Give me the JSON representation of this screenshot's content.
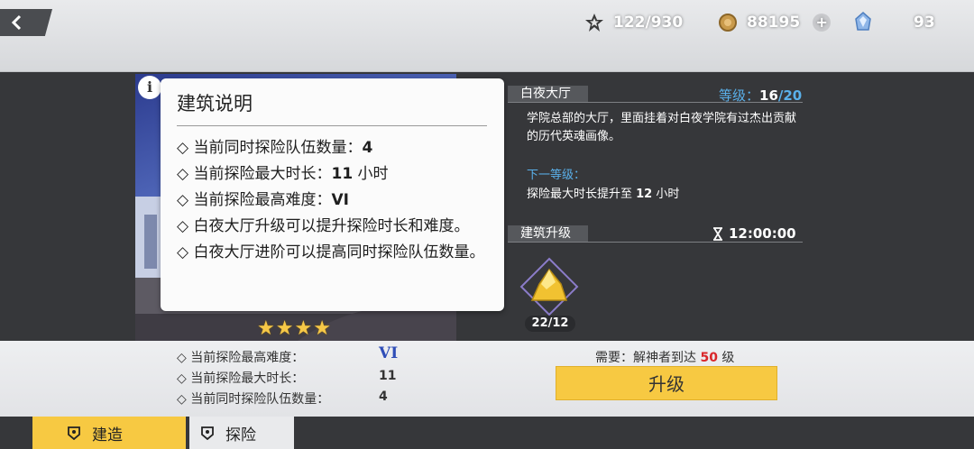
{
  "header": {
    "stamina": "122/930",
    "coins": "88195",
    "crystals": "93"
  },
  "tooltip": {
    "title": "建筑说明",
    "lines": [
      {
        "prefix": "◇ 当前同时探险队伍数量：",
        "value": "4",
        "suffix": ""
      },
      {
        "prefix": "◇ 当前探险最大时长：",
        "value": "11",
        "suffix": " 小时"
      },
      {
        "prefix": "◇ 当前探险最高难度：",
        "value": "VI",
        "suffix": ""
      },
      {
        "text": "◇ 白夜大厅升级可以提升探险时长和难度。"
      },
      {
        "text": "◇ 白夜大厅进阶可以提高同时探险队伍数量。"
      }
    ]
  },
  "building": {
    "name": "白夜大厅",
    "level_label": "等级：",
    "level_current": "16",
    "level_max": "/20",
    "description": "学院总部的大厅，里面挂着对白夜学院有过杰出贡献的历代英魂画像。",
    "next_level_title": "下一等级：",
    "next_level_prefix": "探险最大时长提升至 ",
    "next_level_value": "12",
    "next_level_suffix": " 小时",
    "stars": 4
  },
  "upgrade": {
    "section_label": "建筑升级",
    "timer": "12:00:00",
    "material_count": "22/12",
    "require_prefix": "需要：解神者到达 ",
    "require_level": "50",
    "require_suffix": " 级",
    "button_label": "升级"
  },
  "stats": [
    {
      "label": "◇ 当前探险最高难度：",
      "value": "VI"
    },
    {
      "label": "◇ 当前探险最大时长：",
      "value": "11"
    },
    {
      "label": "◇ 当前同时探险队伍数量：",
      "value": "4"
    }
  ],
  "tabs": [
    {
      "label": "建造",
      "active": true
    },
    {
      "label": "探险",
      "active": false
    }
  ],
  "colors": {
    "accent_yellow": "#f7c942",
    "level_blue": "#5ab0ea",
    "require_red": "#d9262a"
  }
}
